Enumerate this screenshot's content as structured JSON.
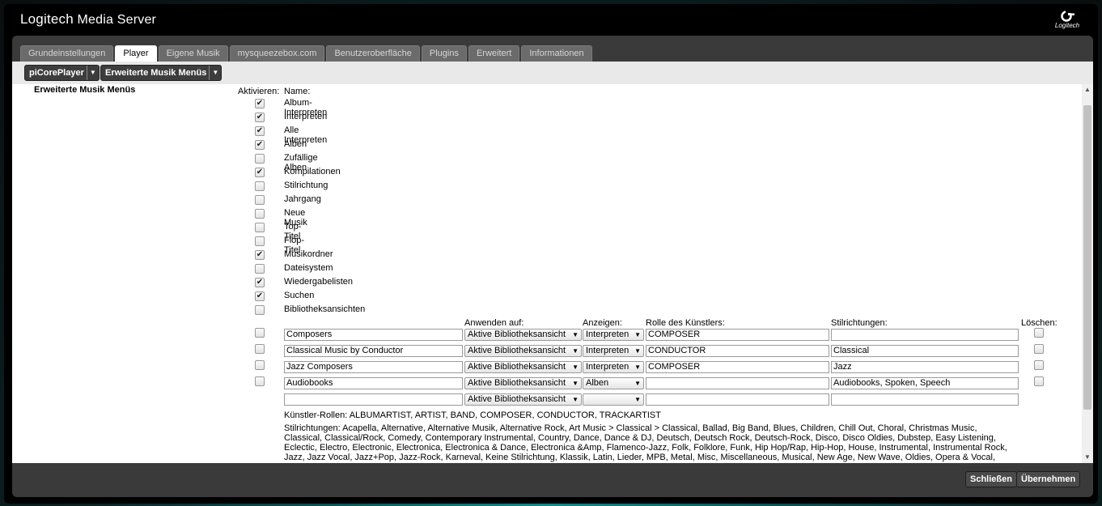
{
  "app": {
    "title_brand": "Logitech",
    "title_rest": "Media Server",
    "logo_text": "Logitech"
  },
  "tabs": [
    {
      "label": "Grundeinstellungen",
      "active": false
    },
    {
      "label": "Player",
      "active": true
    },
    {
      "label": "Eigene Musik",
      "active": false
    },
    {
      "label": "mysqueezebox.com",
      "active": false
    },
    {
      "label": "Benutzeroberfläche",
      "active": false
    },
    {
      "label": "Plugins",
      "active": false
    },
    {
      "label": "Erweitert",
      "active": false
    },
    {
      "label": "Informationen",
      "active": false
    }
  ],
  "subbar": {
    "player": "piCorePlayer",
    "page": "Erweiterte Musik Menüs"
  },
  "section_title": "Erweiterte Musik Menüs",
  "headers": {
    "activate": "Aktivieren:",
    "name": "Name:",
    "apply_to": "Anwenden auf:",
    "show": "Anzeigen:",
    "role": "Rolle des Künstlers:",
    "genres": "Stilrichtungen:",
    "delete": "Löschen:"
  },
  "menus": [
    {
      "label": "Album-Interpreten",
      "checked": true
    },
    {
      "label": "Interpreten",
      "checked": true
    },
    {
      "label": "Alle Interpreten",
      "checked": true
    },
    {
      "label": "Alben",
      "checked": true
    },
    {
      "label": "Zufällige Alben",
      "checked": false
    },
    {
      "label": "Kompilationen",
      "checked": true
    },
    {
      "label": "Stilrichtung",
      "checked": false
    },
    {
      "label": "Jahrgang",
      "checked": false
    },
    {
      "label": "Neue Musik",
      "checked": false
    },
    {
      "label": "Top-Titel",
      "checked": false
    },
    {
      "label": "Flop-Titel",
      "checked": false
    },
    {
      "label": "Musikordner",
      "checked": true
    },
    {
      "label": "Dateisystem",
      "checked": false
    },
    {
      "label": "Wiedergabelisten",
      "checked": true
    },
    {
      "label": "Suchen",
      "checked": true
    },
    {
      "label": "Bibliotheksansichten",
      "checked": false
    }
  ],
  "custom_menus": [
    {
      "name": "Composers",
      "apply": "Aktive Bibliotheksansicht",
      "show": "Interpreten",
      "role": "COMPOSER",
      "genres": "",
      "checked": false
    },
    {
      "name": "Classical Music by Conductor",
      "apply": "Aktive Bibliotheksansicht",
      "show": "Interpreten",
      "role": "CONDUCTOR",
      "genres": "Classical",
      "checked": false
    },
    {
      "name": "Jazz Composers",
      "apply": "Aktive Bibliotheksansicht",
      "show": "Interpreten",
      "role": "COMPOSER",
      "genres": "Jazz",
      "checked": false
    },
    {
      "name": "Audiobooks",
      "apply": "Aktive Bibliotheksansicht",
      "show": "Alben",
      "role": "",
      "genres": "Audiobooks, Spoken, Speech",
      "checked": false
    },
    {
      "name": "",
      "apply": "Aktive Bibliotheksansicht",
      "show": "",
      "role": "",
      "genres": "",
      "checked": null
    }
  ],
  "artist_roles": "Künstler-Rollen: ALBUMARTIST, ARTIST, BAND, COMPOSER, CONDUCTOR, TRACKARTIST",
  "genres_list": "Stilrichtungen: Acapella, Alternative, Alternative Musik, Alternative Rock, Art Music > Classical > Classical, Ballad, Big Band, Blues, Children, Chill Out, Choral, Christmas Music, Classical, Classical/Rock, Comedy, Contemporary Instrumental, Country, Dance, Dance & DJ, Deutsch, Deutsch Rock, Deutsch-Rock, Disco, Disco Oldies, Dubstep, Easy Listening, Eclectic, Electro, Electronic, Electronica, Electronica & Dance, Electronica &Amp, Flamenco-Jazz, Folk, Folklore, Funk, Hip Hop/Rap, Hip-Hop, House, Instrumental, Instrumental Rock, Jazz, Jazz Vocal, Jazz+Pop, Jazz-Rock, Karneval, Keine Stilrichtung, Klassik, Latin, Lieder, MPB, Metal, Misc, Miscellaneous, Musical, New Age, New Wave, Oldies, Opera & Vocal,",
  "footer": {
    "close": "Schließen",
    "apply": "Übernehmen"
  }
}
